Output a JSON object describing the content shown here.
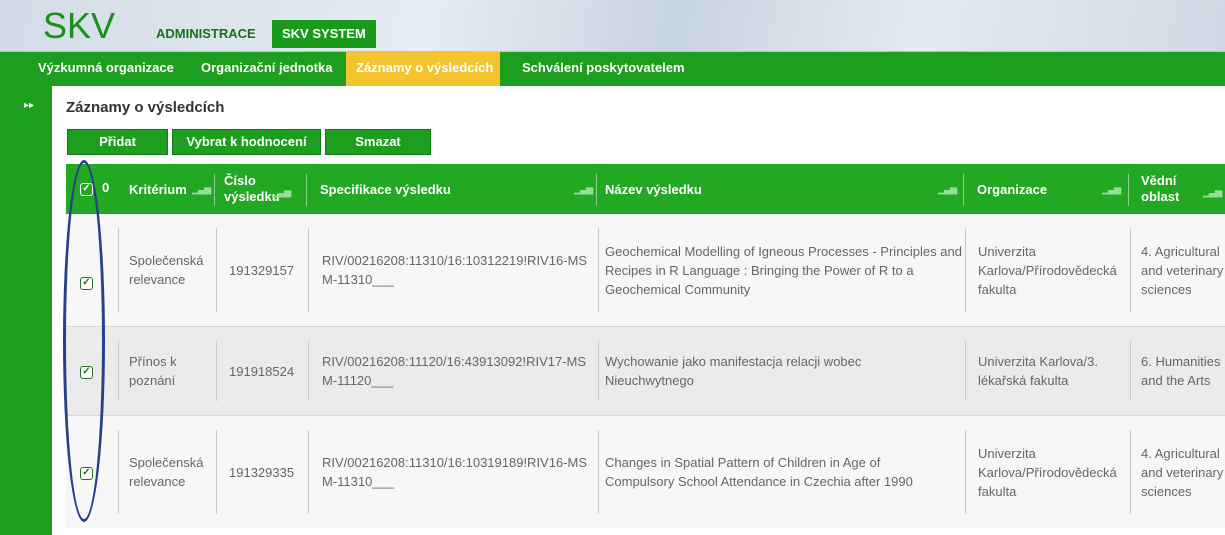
{
  "app": {
    "logo": "SKV",
    "top_tabs": [
      "ADMINISTRACE",
      "SKV SYSTEM"
    ]
  },
  "nav": {
    "items": [
      "Výzkumná organizace",
      "Organizační jednotka",
      "Záznamy o výsledcích",
      "Schválení poskytovatelem"
    ],
    "active": "Záznamy o výsledcích"
  },
  "sidebar": {
    "expand_icon": "double-chevron-right-icon"
  },
  "page": {
    "title": "Záznamy o výsledcích",
    "buttons": [
      "Přidat",
      "Vybrat k hodnocení",
      "Smazat"
    ]
  },
  "table": {
    "select_count": "0",
    "columns": [
      "Kritérium",
      "Číslo výsledku",
      "Specifikace výsledku",
      "Název výsledku",
      "Organizace",
      "Vědní oblast"
    ],
    "rows": [
      {
        "checked": true,
        "kriterium": "Společenská relevance",
        "cislo": "191329157",
        "specifikace": "RIV/00216208:11310/16:10312219!RIV16-MSM-11310___",
        "nazev": "Geochemical Modelling of Igneous Processes - Principles and Recipes in R Language : Bringing the Power of R to a Geochemical Community",
        "organizace": "Univerzita Karlova/Přírodovědecká fakulta",
        "oblast": "4. Agricultural and veterinary sciences"
      },
      {
        "checked": true,
        "kriterium": "Přínos k poznání",
        "cislo": "191918524",
        "specifikace": "RIV/00216208:11120/16:43913092!RIV17-MSM-11120___",
        "nazev": "Wychowanie jako manifestacja relacji wobec Nieuchwytnego",
        "organizace": "Univerzita Karlova/3. lékařská fakulta",
        "oblast": "6. Humanities and the Arts"
      },
      {
        "checked": true,
        "kriterium": "Společenská relevance",
        "cislo": "191329335",
        "specifikace": "RIV/00216208:11310/16:10319189!RIV16-MSM-11310___",
        "nazev": "Changes in Spatial Pattern of Children in Age of Compulsory School Attendance in Czechia after 1990",
        "organizace": "Univerzita Karlova/Přírodovědecká fakulta",
        "oblast": "4. Agricultural and veterinary sciences"
      }
    ]
  },
  "colors": {
    "brand_green": "#1e9e1e",
    "header_green": "#22a822",
    "active_tab": "#f4c430",
    "annotation": "#27408b"
  }
}
